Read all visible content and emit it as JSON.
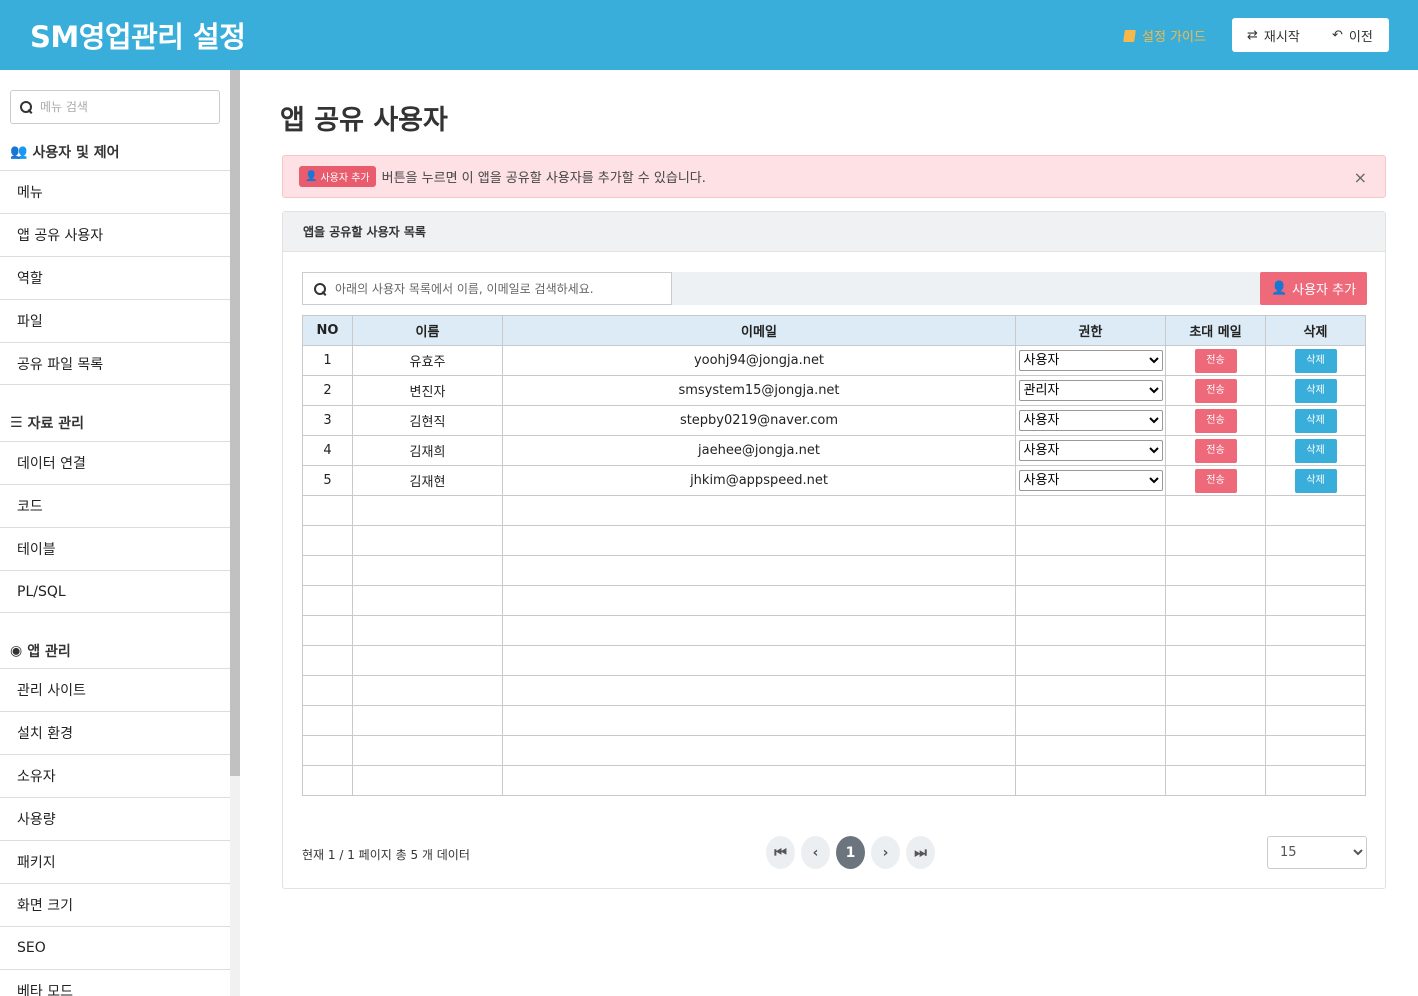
{
  "header": {
    "title": "SM영업관리 설정",
    "guide_label": "설정 가이드",
    "restart_label": "재시작",
    "prev_label": "이전"
  },
  "sidebar": {
    "search_placeholder": "메뉴 검색",
    "sections": [
      {
        "title": "사용자 및 제어",
        "icon": "users-icon",
        "items": [
          "메뉴",
          "앱 공유 사용자",
          "역할",
          "파일",
          "공유 파일 목록"
        ]
      },
      {
        "title": "자료 관리",
        "icon": "database-icon",
        "items": [
          "데이터 연결",
          "코드",
          "테이블",
          "PL/SQL"
        ]
      },
      {
        "title": "앱 관리",
        "icon": "user-circle-icon",
        "items": [
          "관리 사이트",
          "설치 환경",
          "소유자",
          "사용량",
          "패키지",
          "화면 크기",
          "SEO",
          "베타 모드"
        ]
      }
    ]
  },
  "main": {
    "page_title": "앱 공유 사용자",
    "alert": {
      "badge": "사용자 추가",
      "text": "버튼을 누르면 이 앱을 공유할 사용자를 추가할 수 있습니다.",
      "close": "×"
    },
    "panel_title": "앱을 공유할 사용자 목록",
    "filter_placeholder": "아래의 사용자 목록에서 이름, 이메일로 검색하세요.",
    "add_button": "사용자 추가",
    "table": {
      "headers": [
        "NO",
        "이름",
        "이메일",
        "권한",
        "초대 메일",
        "삭제"
      ],
      "rows": [
        {
          "no": "1",
          "name": "유효주",
          "email": "yoohj94@jongja.net",
          "role": "사용자"
        },
        {
          "no": "2",
          "name": "변진자",
          "email": "smsystem15@jongja.net",
          "role": "관리자"
        },
        {
          "no": "3",
          "name": "김현직",
          "email": "stepby0219@naver.com",
          "role": "사용자"
        },
        {
          "no": "4",
          "name": "김재희",
          "email": "jaehee@jongja.net",
          "role": "사용자"
        },
        {
          "no": "5",
          "name": "김재현",
          "email": "jhkim@appspeed.net",
          "role": "사용자"
        }
      ],
      "send_label": "전송",
      "delete_label": "삭제",
      "role_options": [
        "사용자",
        "관리자"
      ]
    },
    "page_info": "현재 1 / 1 페이지 총 5 개 데이터",
    "current_page": "1",
    "page_size": "15"
  },
  "colors": {
    "header_bg": "#3aaedb",
    "accent_red": "#ee6a7b",
    "accent_blue": "#3aaedb",
    "guide_orange": "#f4b94a"
  }
}
